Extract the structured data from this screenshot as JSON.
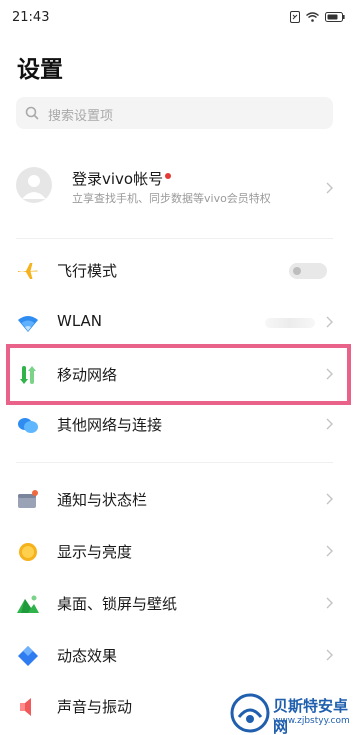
{
  "status_bar": {
    "time": "21:43"
  },
  "page": {
    "title": "设置"
  },
  "search": {
    "placeholder": "搜索设置项"
  },
  "account": {
    "title": "登录vivo帐号",
    "subtitle": "立享查找手机、同步数据等vivo会员特权"
  },
  "sections": [
    {
      "items": [
        {
          "name": "airplane-mode",
          "label": "飞行模式",
          "icon": "airplane-icon",
          "control": "toggle",
          "toggle_on": false
        },
        {
          "name": "wlan",
          "label": "WLAN",
          "icon": "wifi-icon",
          "control": "chevron"
        },
        {
          "name": "mobile-network",
          "label": "移动网络",
          "icon": "mobile-network-icon",
          "control": "chevron",
          "highlighted": true
        },
        {
          "name": "other-networks",
          "label": "其他网络与连接",
          "icon": "other-networks-icon",
          "control": "chevron"
        }
      ]
    },
    {
      "items": [
        {
          "name": "notifications",
          "label": "通知与状态栏",
          "icon": "notification-icon",
          "control": "chevron"
        },
        {
          "name": "display",
          "label": "显示与亮度",
          "icon": "brightness-icon",
          "control": "chevron"
        },
        {
          "name": "wallpaper",
          "label": "桌面、锁屏与壁纸",
          "icon": "wallpaper-icon",
          "control": "chevron"
        },
        {
          "name": "effects",
          "label": "动态效果",
          "icon": "effects-icon",
          "control": "chevron"
        },
        {
          "name": "sound",
          "label": "声音与振动",
          "icon": "sound-icon",
          "control": "chevron"
        }
      ]
    }
  ],
  "watermark": {
    "name": "贝斯特安卓网",
    "url": "www.zjbstyy.com"
  },
  "colors": {
    "highlight": "#e8628a",
    "accent_green": "#2fb34a",
    "wifi_blue": "#2f8cf0",
    "airplane_yellow": "#f5b21b"
  }
}
